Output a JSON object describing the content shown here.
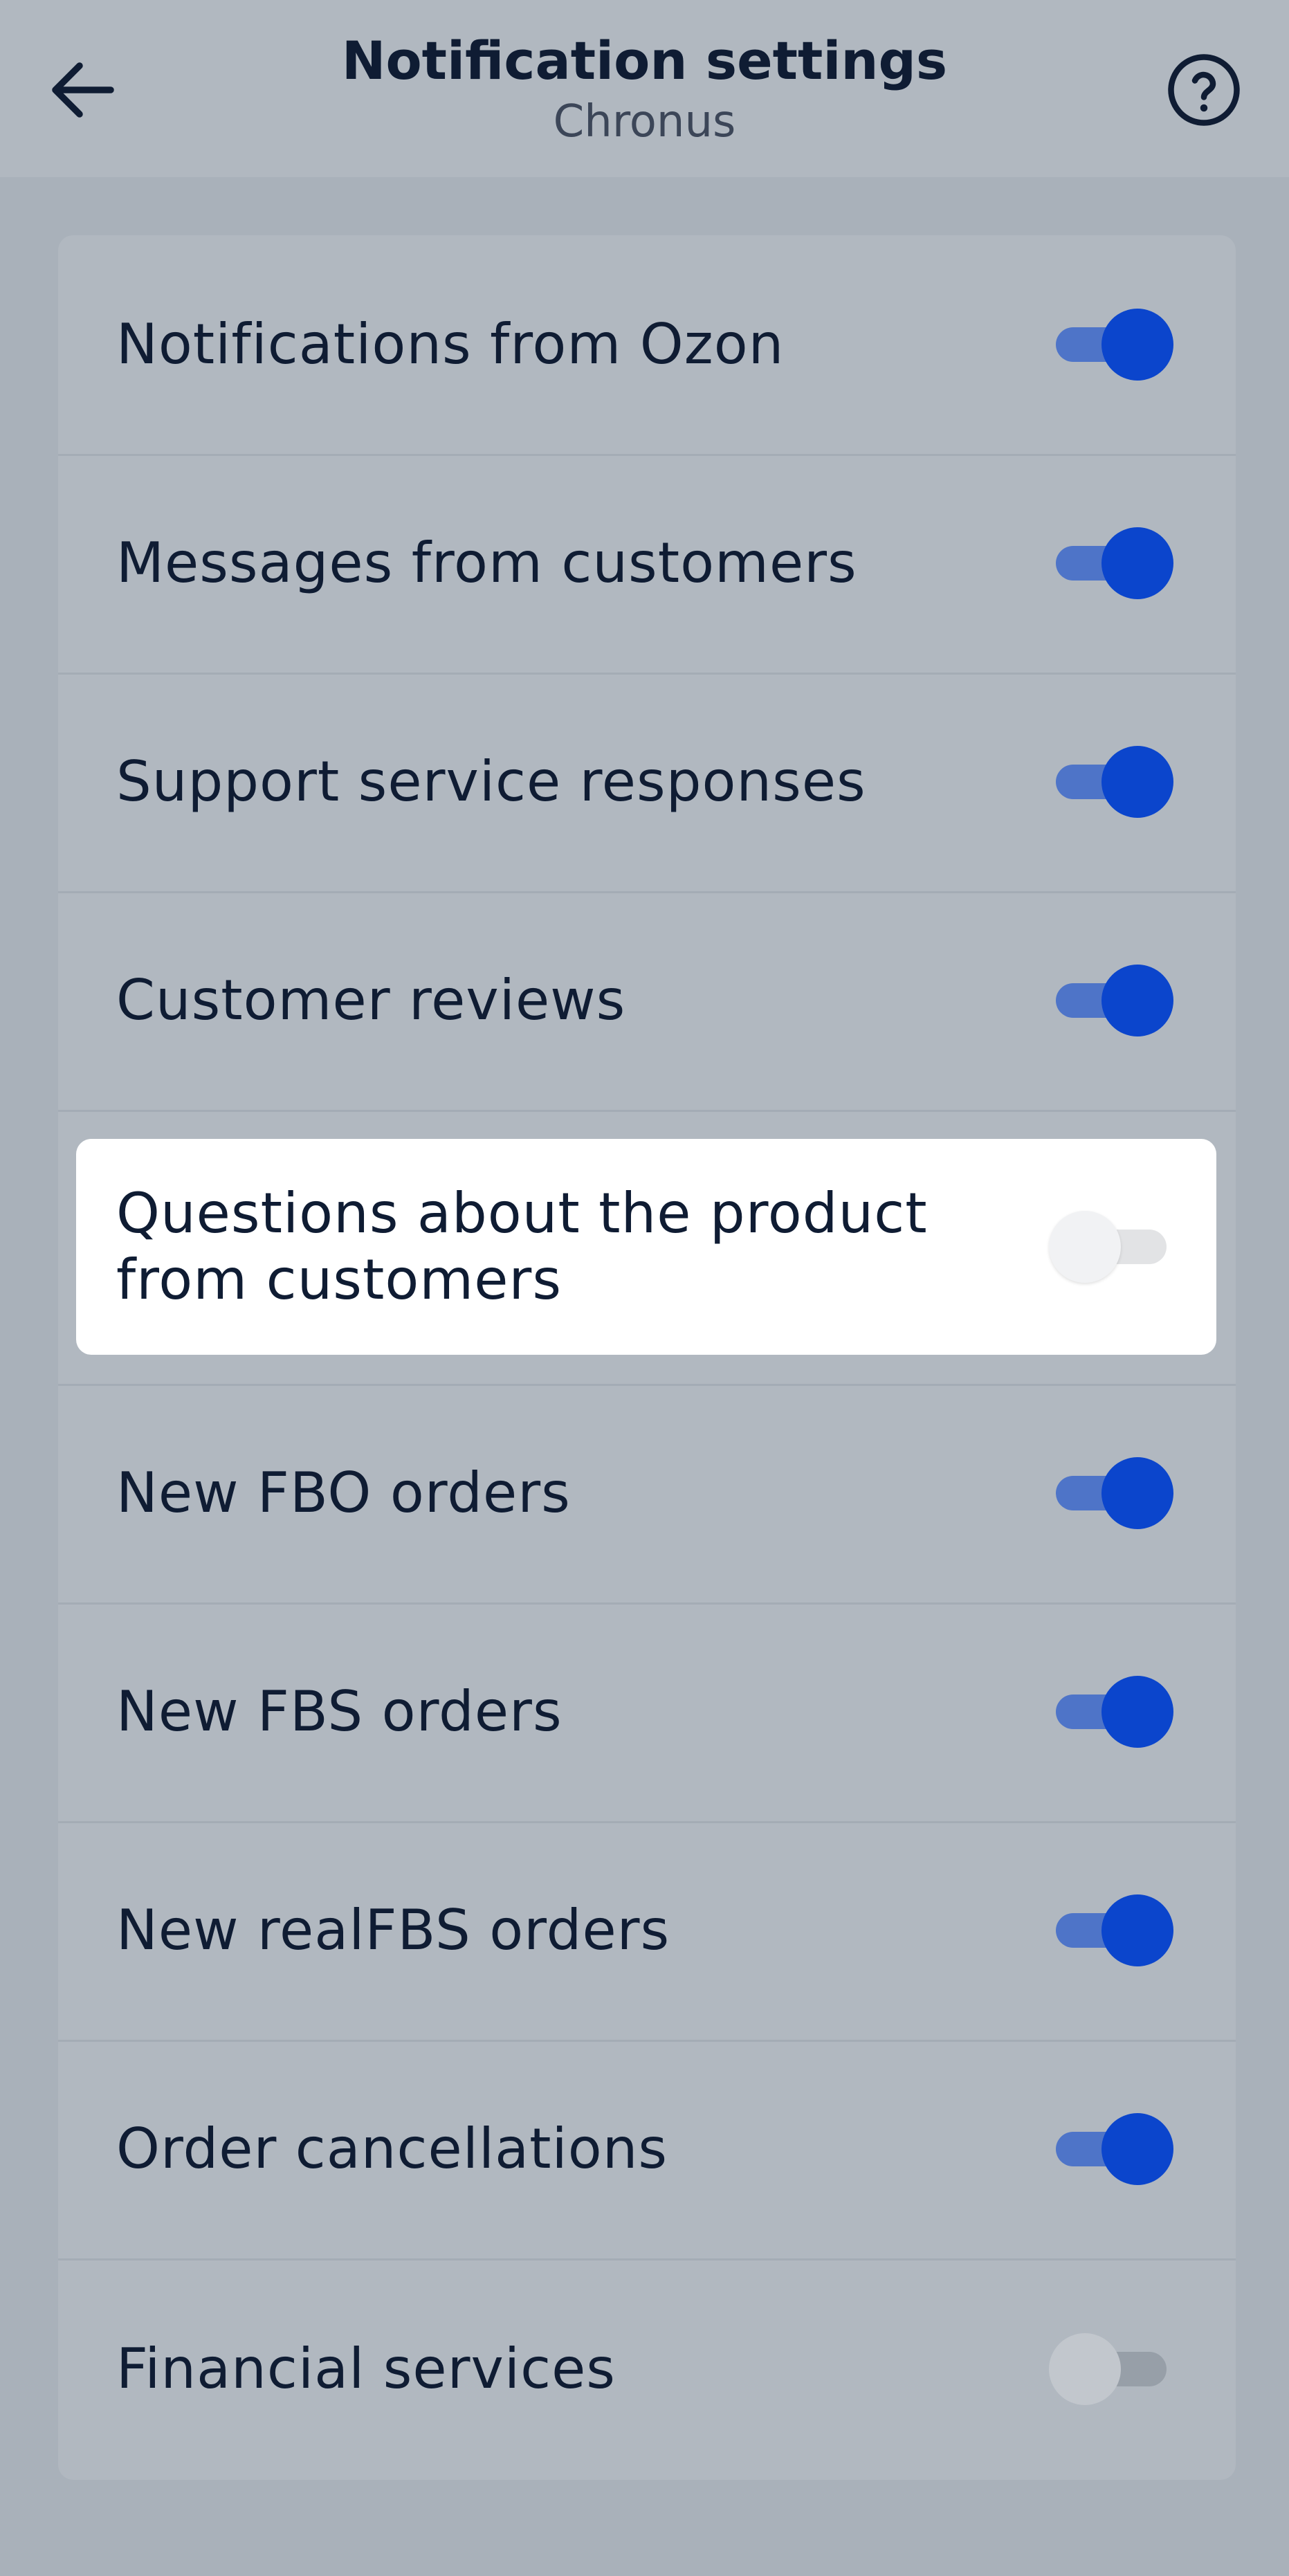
{
  "header": {
    "title": "Notification settings",
    "subtitle": "Chronus",
    "back_icon": "arrow-left-icon",
    "help_icon": "question-circle-icon"
  },
  "settings": [
    {
      "label": "Notifications from Ozon",
      "enabled": true
    },
    {
      "label": "Messages from customers",
      "enabled": true
    },
    {
      "label": "Support service responses",
      "enabled": true
    },
    {
      "label": "Customer reviews",
      "enabled": true
    },
    {
      "label": "Questions about the product from customers",
      "enabled": false,
      "highlighted": true
    },
    {
      "label": "New FBO orders",
      "enabled": true
    },
    {
      "label": "New FBS orders",
      "enabled": true
    },
    {
      "label": "New realFBS orders",
      "enabled": true
    },
    {
      "label": "Order cancellations",
      "enabled": true
    },
    {
      "label": "Financial services",
      "enabled": false
    }
  ],
  "colors": {
    "toggle_on_knob": "#0b45cc",
    "toggle_on_track": "#4e74c8",
    "text_primary": "#0f1c33",
    "highlight_bg": "#ffffff"
  }
}
